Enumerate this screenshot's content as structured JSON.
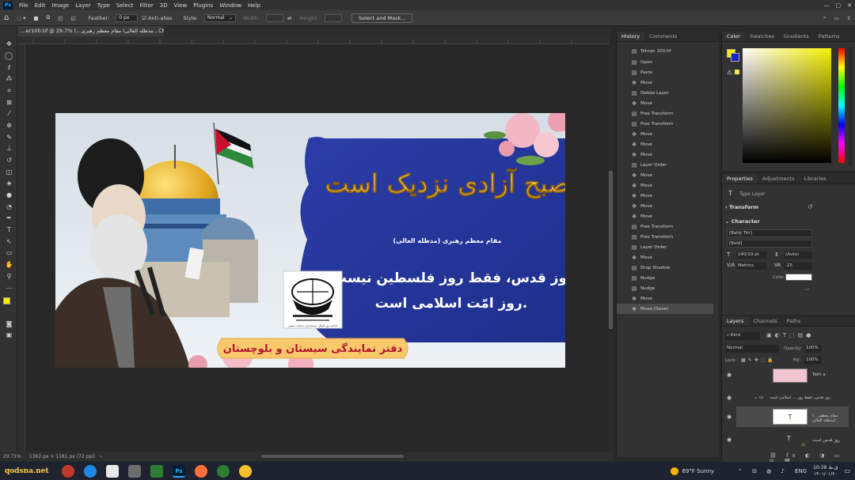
{
  "menubar": {
    "app_icon": "Ps",
    "items": [
      "File",
      "Edit",
      "Image",
      "Layer",
      "Type",
      "Select",
      "Filter",
      "3D",
      "View",
      "Plugins",
      "Window",
      "Help"
    ]
  },
  "options": {
    "feather_label": "Feather:",
    "feather_value": "0 px",
    "antialias_label": "Anti-alias",
    "style_label": "Style:",
    "style_value": "Normal",
    "width_label": "Width:",
    "height_label": "Height:",
    "select_mask_label": "Select and Mask..."
  },
  "document": {
    "tab_title": "…er100.tif @ 29.7% (…مقام معظم رهبری (مدظله العالی , CMYK/8#)"
  },
  "artwork": {
    "headline": "صبح آزادی نزدیک است",
    "attribution": "مقام معظم رهبری (مدظله العالی)",
    "quote_line1": "روز قدس، فقط روز فلسطین نیست؛",
    "quote_line2": "روز امّت اسلامی است.",
    "logo_caption": "اتحادیه بین المللی دوستداران حماسه حسینی",
    "office_label": "دفتر نمایندگی سیستان و بلوچستان"
  },
  "statusbar": {
    "zoom": "29.71%",
    "dims": "1362 px × 1181 px (72 ppi)"
  },
  "history": {
    "tabs": [
      "History",
      "Comments"
    ],
    "snapshot": "Tehran 100.tif",
    "items": [
      {
        "icon": "doc-icon",
        "label": "Open"
      },
      {
        "icon": "doc-icon",
        "label": "Paste"
      },
      {
        "icon": "move-icon",
        "label": "Move"
      },
      {
        "icon": "doc-icon",
        "label": "Delete Layer"
      },
      {
        "icon": "move-icon",
        "label": "Move"
      },
      {
        "icon": "doc-icon",
        "label": "Free Transform"
      },
      {
        "icon": "doc-icon",
        "label": "Free Transform"
      },
      {
        "icon": "move-icon",
        "label": "Move"
      },
      {
        "icon": "move-icon",
        "label": "Move"
      },
      {
        "icon": "move-icon",
        "label": "Move"
      },
      {
        "icon": "doc-icon",
        "label": "Layer Order"
      },
      {
        "icon": "move-icon",
        "label": "Move"
      },
      {
        "icon": "move-icon",
        "label": "Move"
      },
      {
        "icon": "move-icon",
        "label": "Move"
      },
      {
        "icon": "move-icon",
        "label": "Move"
      },
      {
        "icon": "move-icon",
        "label": "Move"
      },
      {
        "icon": "doc-icon",
        "label": "Free Transform"
      },
      {
        "icon": "doc-icon",
        "label": "Free Transform"
      },
      {
        "icon": "doc-icon",
        "label": "Layer Order"
      },
      {
        "icon": "move-icon",
        "label": "Move"
      },
      {
        "icon": "doc-icon",
        "label": "Drop Shadow"
      },
      {
        "icon": "doc-icon",
        "label": "Nudge"
      },
      {
        "icon": "doc-icon",
        "label": "Nudge"
      },
      {
        "icon": "move-icon",
        "label": "Move"
      },
      {
        "icon": "move-icon",
        "label": "Move (Save)"
      }
    ]
  },
  "color_panel": {
    "tabs": [
      "Color",
      "Swatches",
      "Gradients",
      "Patterns"
    ],
    "foreground": "#f5f000",
    "background": "#1a24c8"
  },
  "properties": {
    "tabs": [
      "Properties",
      "Adjustments",
      "Libraries"
    ],
    "layer_type": "Type Layer",
    "transform_label": "Transform",
    "character_label": "Character",
    "font_family": "[Bahij Titr]",
    "font_style": "[Bold]",
    "font_size": "140/19 pt",
    "leading": "(Auto)",
    "kerning": "Metrics",
    "tracking": "-25",
    "color_label": "Color"
  },
  "layers": {
    "tabs": [
      "Layers",
      "Channels",
      "Paths"
    ],
    "filter_kind": "Kind",
    "blend_mode": "Normal",
    "opacity_label": "Opacity:",
    "opacity": "100%",
    "lock_label": "Lock:",
    "fill_label": "Fill:",
    "fill": "100%",
    "items": [
      {
        "name": "Tarh a",
        "kind": "image"
      },
      {
        "name": "روز قدس، فقط روز ... اسلامی است",
        "kind": "group"
      },
      {
        "name": "(مقام معظم ... مدظله العالی)",
        "kind": "text"
      },
      {
        "name": "روز قدس است",
        "kind": "text"
      }
    ]
  },
  "taskbar": {
    "brand": "qodsna.net",
    "weather": "69°F  Sunny",
    "lang": "ENG",
    "time": "10:38 ق.ظ",
    "date": "۱۴۰۱/۰۱/۲۰"
  }
}
